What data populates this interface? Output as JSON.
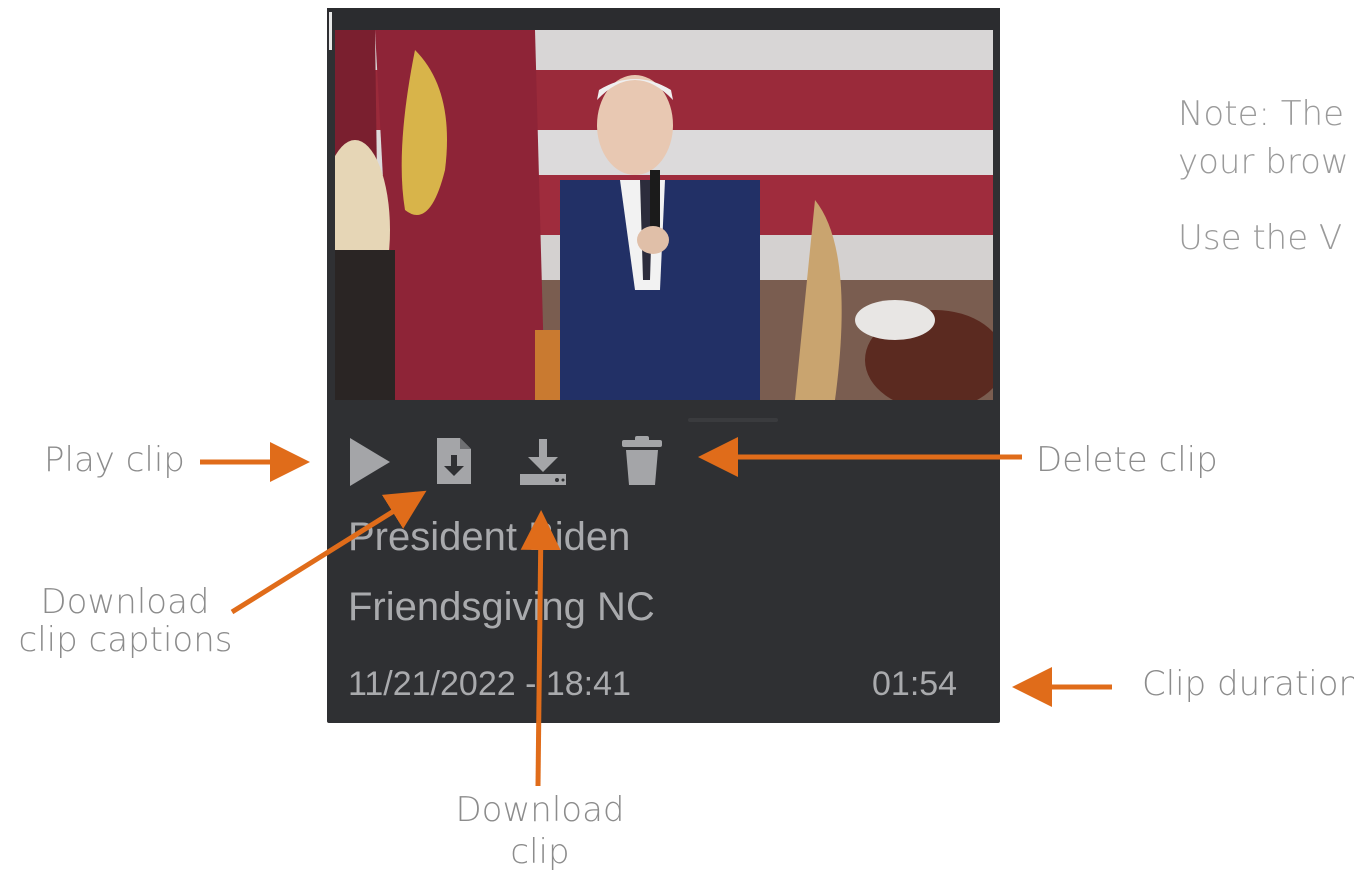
{
  "clip_card": {
    "title_line1": "President Biden",
    "title_line2": "Friendsgiving NC",
    "date": "11/21/2022 - 18:41",
    "duration": "01:54"
  },
  "icons": {
    "play": "play-icon",
    "captions": "file-download-icon",
    "download": "download-icon",
    "delete": "trash-icon"
  },
  "annotations": {
    "play_clip": "Play clip",
    "download_captions_line1": "Download",
    "download_captions_line2": "clip captions",
    "download_clip_line1": "Download",
    "download_clip_line2": "clip",
    "delete_clip": "Delete clip",
    "clip_duration": "Clip duration"
  },
  "note": {
    "line1": "Note: The",
    "line2": "your brow",
    "line3": "Use the V"
  },
  "colors": {
    "card_background": "#2f3033",
    "card_text": "#a9aaad",
    "icon": "#a4a5a8",
    "arrow": "#e06c1a",
    "annotation_text": "#8c8c8c"
  }
}
